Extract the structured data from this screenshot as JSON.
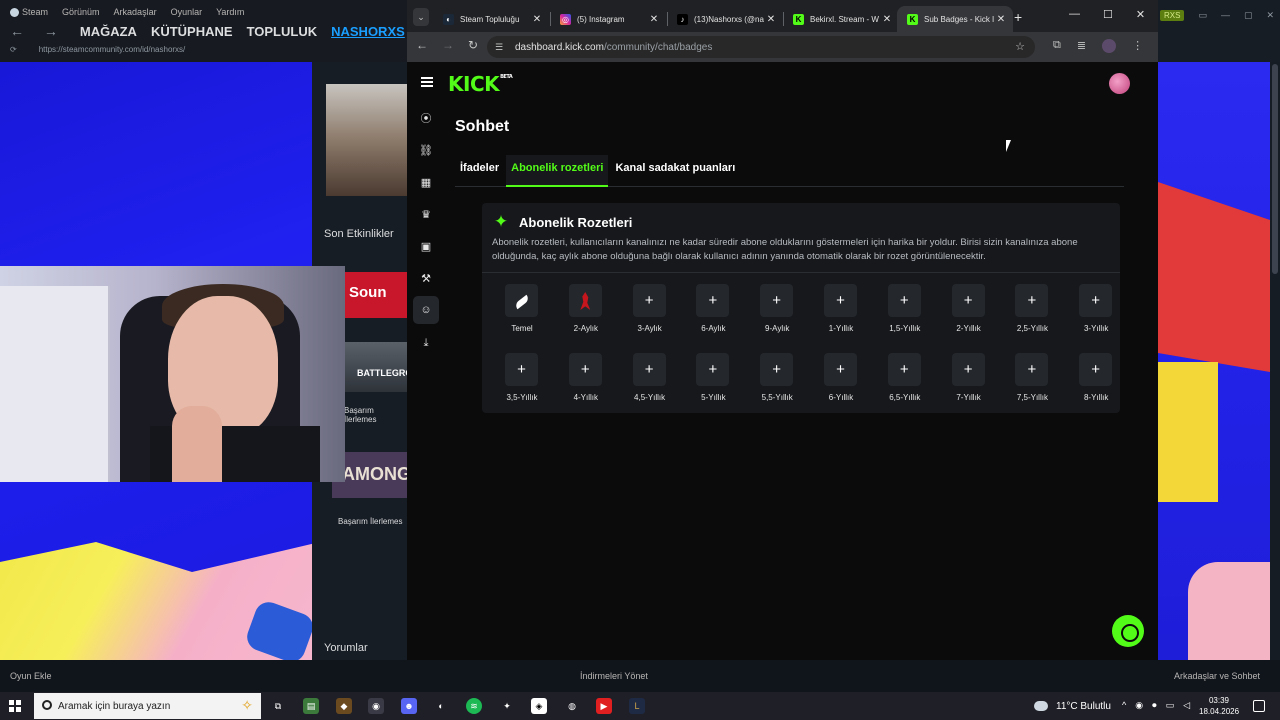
{
  "steam": {
    "menu": [
      "Steam",
      "Görünüm",
      "Arkadaşlar",
      "Oyunlar",
      "Yardım"
    ],
    "nav": {
      "back_forward": "← →",
      "store": "MAĞAZA",
      "library": "KÜTÜPHANE",
      "community": "TOPLULUK",
      "profile": "NASHORXS"
    },
    "url": "https://steamcommunity.com/id/nashorxs/",
    "recent_activity": "Son Etkinlikler",
    "game_sound": "Soun",
    "game_pubg": "BATTLEGRO",
    "achievement_progress_1": "Başarım İlerlemes",
    "game_among": "AMONG",
    "achievement_progress_2": "Başarım İlerlemes",
    "comments": "Yorumlar",
    "account_badge": "RXS",
    "bottom": {
      "add_game": "Oyun Ekle",
      "manage_downloads": "İndirmeleri Yönet",
      "friends_chat": "Arkadaşlar ve Sohbet"
    }
  },
  "browser": {
    "tabs": [
      {
        "title": "Steam Topluluğu",
        "favicon": "steam-icon"
      },
      {
        "title": "(5) Instagram",
        "favicon": "instagram-icon"
      },
      {
        "title": "(13)Nashorxs (@na",
        "favicon": "tiktok-icon"
      },
      {
        "title": "Bekirxl. Stream - W",
        "favicon": "kick-icon"
      },
      {
        "title": "Sub Badges - Kick I",
        "favicon": "kick-icon"
      }
    ],
    "address_host": "dashboard.kick.com",
    "address_path": "/community/chat/badges"
  },
  "kick": {
    "logo": "KICK",
    "logo_beta": "BETA",
    "page_title": "Sohbet",
    "tabs": [
      "İfadeler",
      "Abonelik rozetleri",
      "Kanal sadakat puanları"
    ],
    "active_tab": "Abonelik rozetleri",
    "card": {
      "title": "Abonelik Rozetleri",
      "description": "Abonelik rozetleri, kullanıcıların kanalınızı ne kadar süredir abone olduklarını göstermeleri için harika bir yoldur. Birisi sizin kanalınıza abone olduğunda, kaç aylık abone olduğuna bağlı olarak kullanıcı adının yanında otomatik olarak bir rozet görüntülenecektir."
    },
    "badges": [
      {
        "label": "Temel",
        "state": "set",
        "icon": "feather-badge-icon"
      },
      {
        "label": "2-Aylık",
        "state": "set",
        "icon": "red-figure-badge-icon"
      },
      {
        "label": "3-Aylık",
        "state": "empty",
        "icon": "+"
      },
      {
        "label": "6-Aylık",
        "state": "empty",
        "icon": "+"
      },
      {
        "label": "9-Aylık",
        "state": "empty",
        "icon": "+"
      },
      {
        "label": "1-Yıllık",
        "state": "empty",
        "icon": "+"
      },
      {
        "label": "1,5-Yıllık",
        "state": "empty",
        "icon": "+"
      },
      {
        "label": "2-Yıllık",
        "state": "empty",
        "icon": "+"
      },
      {
        "label": "2,5-Yıllık",
        "state": "empty",
        "icon": "+"
      },
      {
        "label": "3-Yıllık",
        "state": "empty",
        "icon": "+"
      },
      {
        "label": "3,5-Yıllık",
        "state": "empty",
        "icon": "+"
      },
      {
        "label": "4-Yıllık",
        "state": "empty",
        "icon": "+"
      },
      {
        "label": "4,5-Yıllık",
        "state": "empty",
        "icon": "+"
      },
      {
        "label": "5-Yıllık",
        "state": "empty",
        "icon": "+"
      },
      {
        "label": "5,5-Yıllık",
        "state": "empty",
        "icon": "+"
      },
      {
        "label": "6-Yıllık",
        "state": "empty",
        "icon": "+"
      },
      {
        "label": "6,5-Yıllık",
        "state": "empty",
        "icon": "+"
      },
      {
        "label": "7-Yıllık",
        "state": "empty",
        "icon": "+"
      },
      {
        "label": "7,5-Yıllık",
        "state": "empty",
        "icon": "+"
      },
      {
        "label": "8-Yıllık",
        "state": "empty",
        "icon": "+"
      }
    ],
    "accent": "#53fc18"
  },
  "taskbar": {
    "search_placeholder": "Aramak için buraya yazın",
    "weather": "11°C  Bulutlu",
    "time": "03:39",
    "date": "18.04.2026"
  }
}
